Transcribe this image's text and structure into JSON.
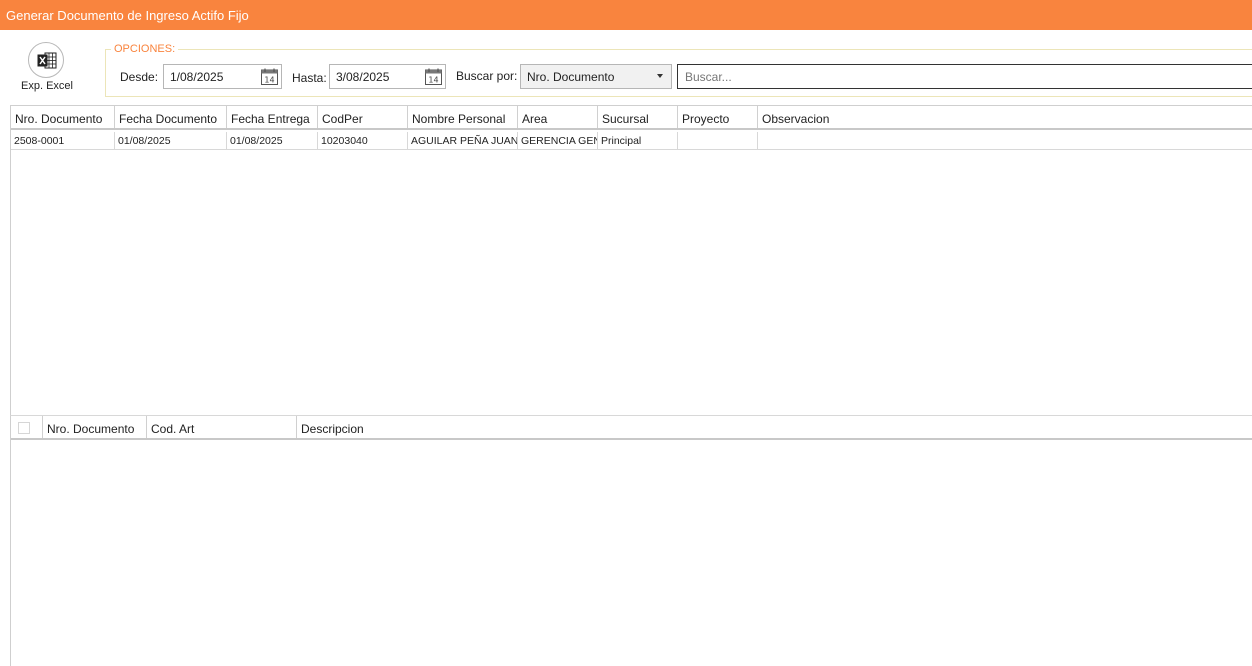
{
  "window": {
    "title": "Generar Documento de Ingreso Actifo Fijo"
  },
  "toolbar": {
    "export_label": "Exp. Excel",
    "export_icon": "excel-icon"
  },
  "options": {
    "legend": "OPCIONES:",
    "desde_label": "Desde:",
    "desde_value": "1/08/2025",
    "hasta_label": "Hasta:",
    "hasta_value": "3/08/2025",
    "buscar_por_label": "Buscar por:",
    "buscar_por_value": "Nro. Documento",
    "search_placeholder": "Buscar..."
  },
  "main_grid": {
    "columns": [
      "Nro. Documento",
      "Fecha Documento",
      "Fecha Entrega",
      "CodPer",
      "Nombre Personal",
      "Area",
      "Sucursal",
      "Proyecto",
      "Observacion"
    ],
    "rows": [
      [
        "2508-0001",
        "01/08/2025",
        "01/08/2025",
        "10203040",
        "AGUILAR PEÑA JUAN",
        "GERENCIA GEN",
        "Principal",
        "",
        ""
      ]
    ]
  },
  "detail_grid": {
    "columns": [
      "Nro. Documento",
      "Cod. Art",
      "Descripcion"
    ]
  },
  "colors": {
    "accent": "#f9843e",
    "legend_border": "#ece5b8"
  }
}
